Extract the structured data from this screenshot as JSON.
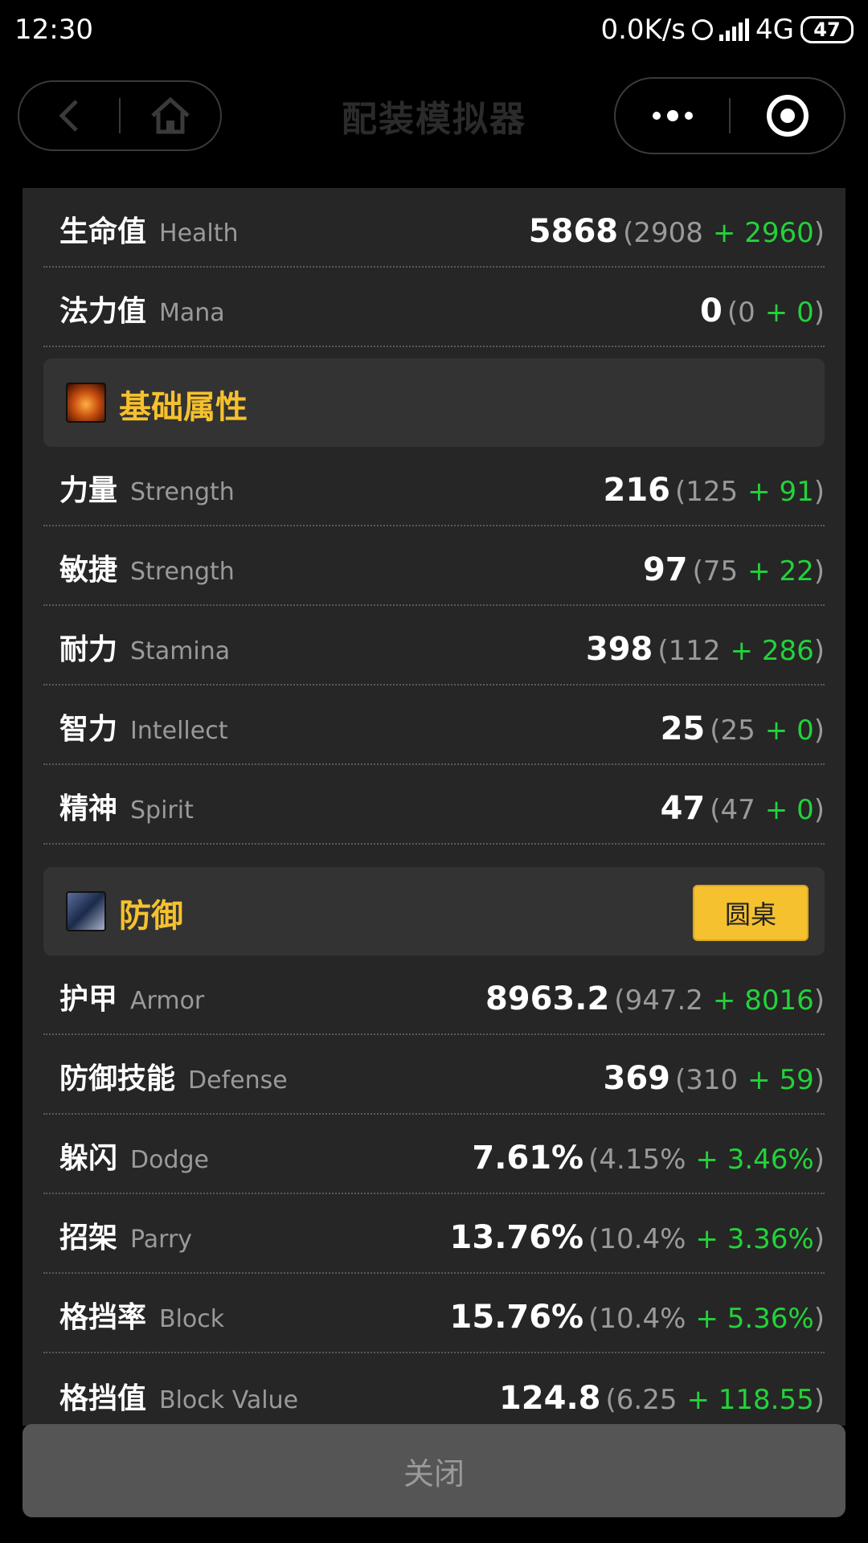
{
  "status_bar": {
    "time": "12:30",
    "speed": "0.0K/s",
    "network": "4G",
    "battery": "47"
  },
  "nav": {
    "title": "配装模拟器"
  },
  "rows_top": [
    {
      "zh": "生命值",
      "en": "Health",
      "total": "5868",
      "base": "2908",
      "bonus": "+ 2960"
    },
    {
      "zh": "法力值",
      "en": "Mana",
      "total": "0",
      "base": "0",
      "bonus": "+ 0"
    }
  ],
  "section_base": {
    "icon": "bull-icon",
    "title": "基础属性"
  },
  "rows_base": [
    {
      "zh": "力量",
      "en": "Strength",
      "total": "216",
      "base": "125",
      "bonus": "+ 91"
    },
    {
      "zh": "敏捷",
      "en": "Strength",
      "total": "97",
      "base": "75",
      "bonus": "+ 22"
    },
    {
      "zh": "耐力",
      "en": "Stamina",
      "total": "398",
      "base": "112",
      "bonus": "+ 286"
    },
    {
      "zh": "智力",
      "en": "Intellect",
      "total": "25",
      "base": "25",
      "bonus": "+ 0"
    },
    {
      "zh": "精神",
      "en": "Spirit",
      "total": "47",
      "base": "47",
      "bonus": "+ 0"
    }
  ],
  "section_defense": {
    "icon": "shield-icon",
    "title": "防御",
    "button": "圆桌"
  },
  "rows_defense": [
    {
      "zh": "护甲",
      "en": "Armor",
      "total": "8963.2",
      "base": "947.2",
      "bonus": "+ 8016"
    },
    {
      "zh": "防御技能",
      "en": "Defense",
      "total": "369",
      "base": "310",
      "bonus": "+ 59"
    },
    {
      "zh": "躲闪",
      "en": "Dodge",
      "total": "7.61%",
      "base": "4.15%",
      "bonus": "+ 3.46%"
    },
    {
      "zh": "招架",
      "en": "Parry",
      "total": "13.76%",
      "base": "10.4%",
      "bonus": "+ 3.36%"
    },
    {
      "zh": "格挡率",
      "en": "Block",
      "total": "15.76%",
      "base": "10.4%",
      "bonus": "+ 5.36%"
    },
    {
      "zh": "格挡值",
      "en": "Block Value",
      "total": "124.8",
      "base": "6.25",
      "bonus": "+ 118.55"
    }
  ],
  "close_label": "关闭",
  "colors": {
    "accent": "#f5c12e",
    "bonus": "#23d23a",
    "panel": "#262626",
    "section": "#333333"
  }
}
